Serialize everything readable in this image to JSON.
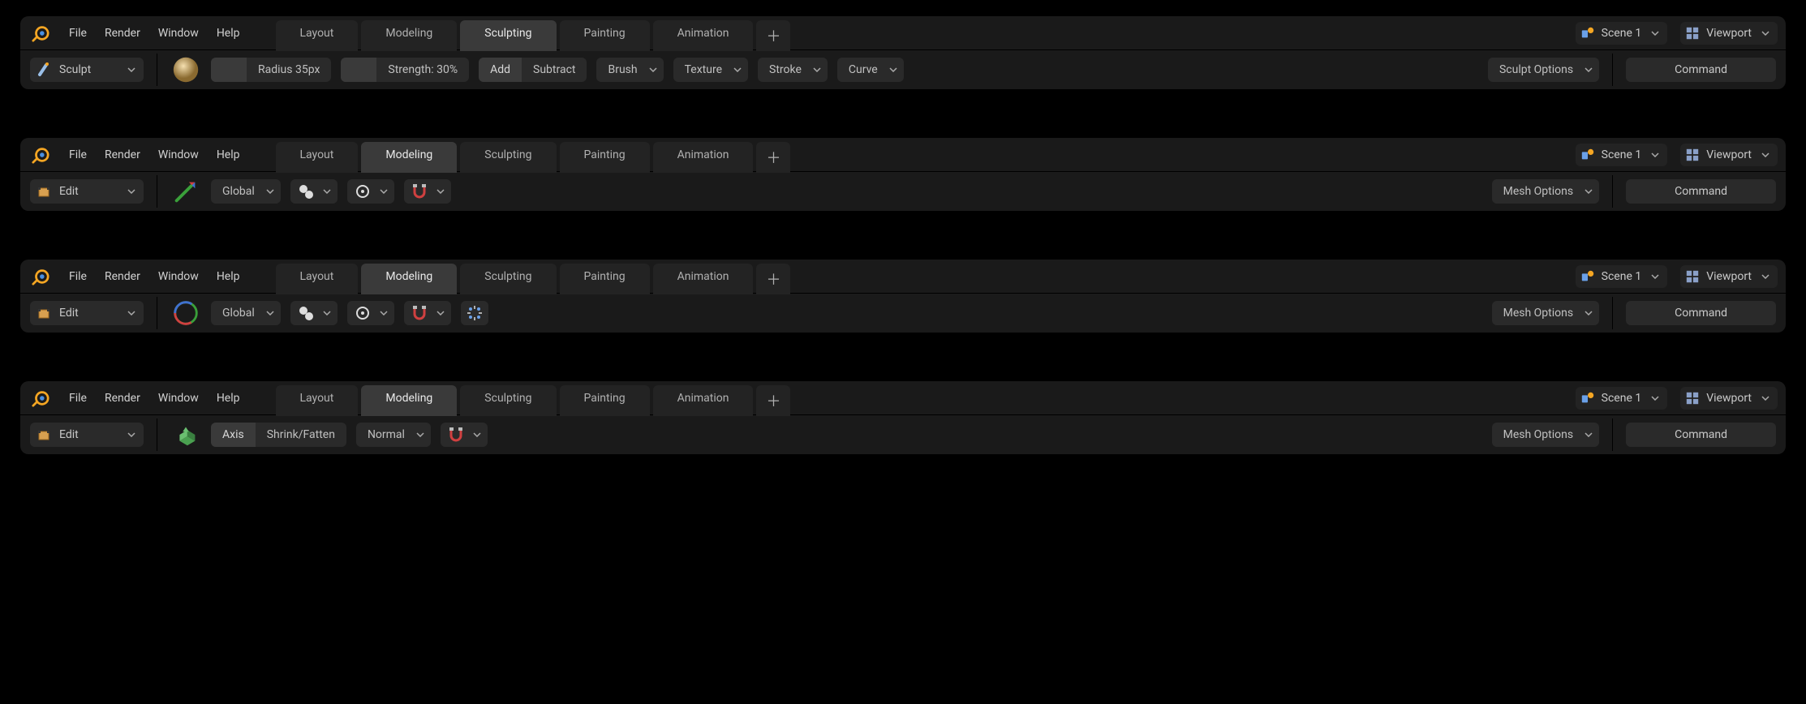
{
  "menu": {
    "file": "File",
    "render": "Render",
    "window": "Window",
    "help": "Help"
  },
  "tabs": {
    "layout": "Layout",
    "modeling": "Modeling",
    "sculpting": "Sculpting",
    "painting": "Painting",
    "animation": "Animation"
  },
  "scene": {
    "label": "Scene 1"
  },
  "viewport": {
    "label": "Viewport"
  },
  "panels": [
    {
      "active_tab": "sculpting",
      "mode": "Sculpt",
      "radius": "Radius 35px",
      "strength": "Strength: 30%",
      "add": "Add",
      "subtract": "Subtract",
      "brush": "Brush",
      "texture": "Texture",
      "stroke": "Stroke",
      "curve": "Curve",
      "options": "Sculpt Options",
      "command": "Command"
    },
    {
      "active_tab": "modeling",
      "mode": "Edit",
      "global": "Global",
      "options": "Mesh Options",
      "command": "Command"
    },
    {
      "active_tab": "modeling",
      "mode": "Edit",
      "global": "Global",
      "options": "Mesh Options",
      "command": "Command"
    },
    {
      "active_tab": "modeling",
      "mode": "Edit",
      "axis": "Axis",
      "shrinkfatten": "Shrink/Fatten",
      "normal": "Normal",
      "options": "Mesh Options",
      "command": "Command"
    }
  ]
}
